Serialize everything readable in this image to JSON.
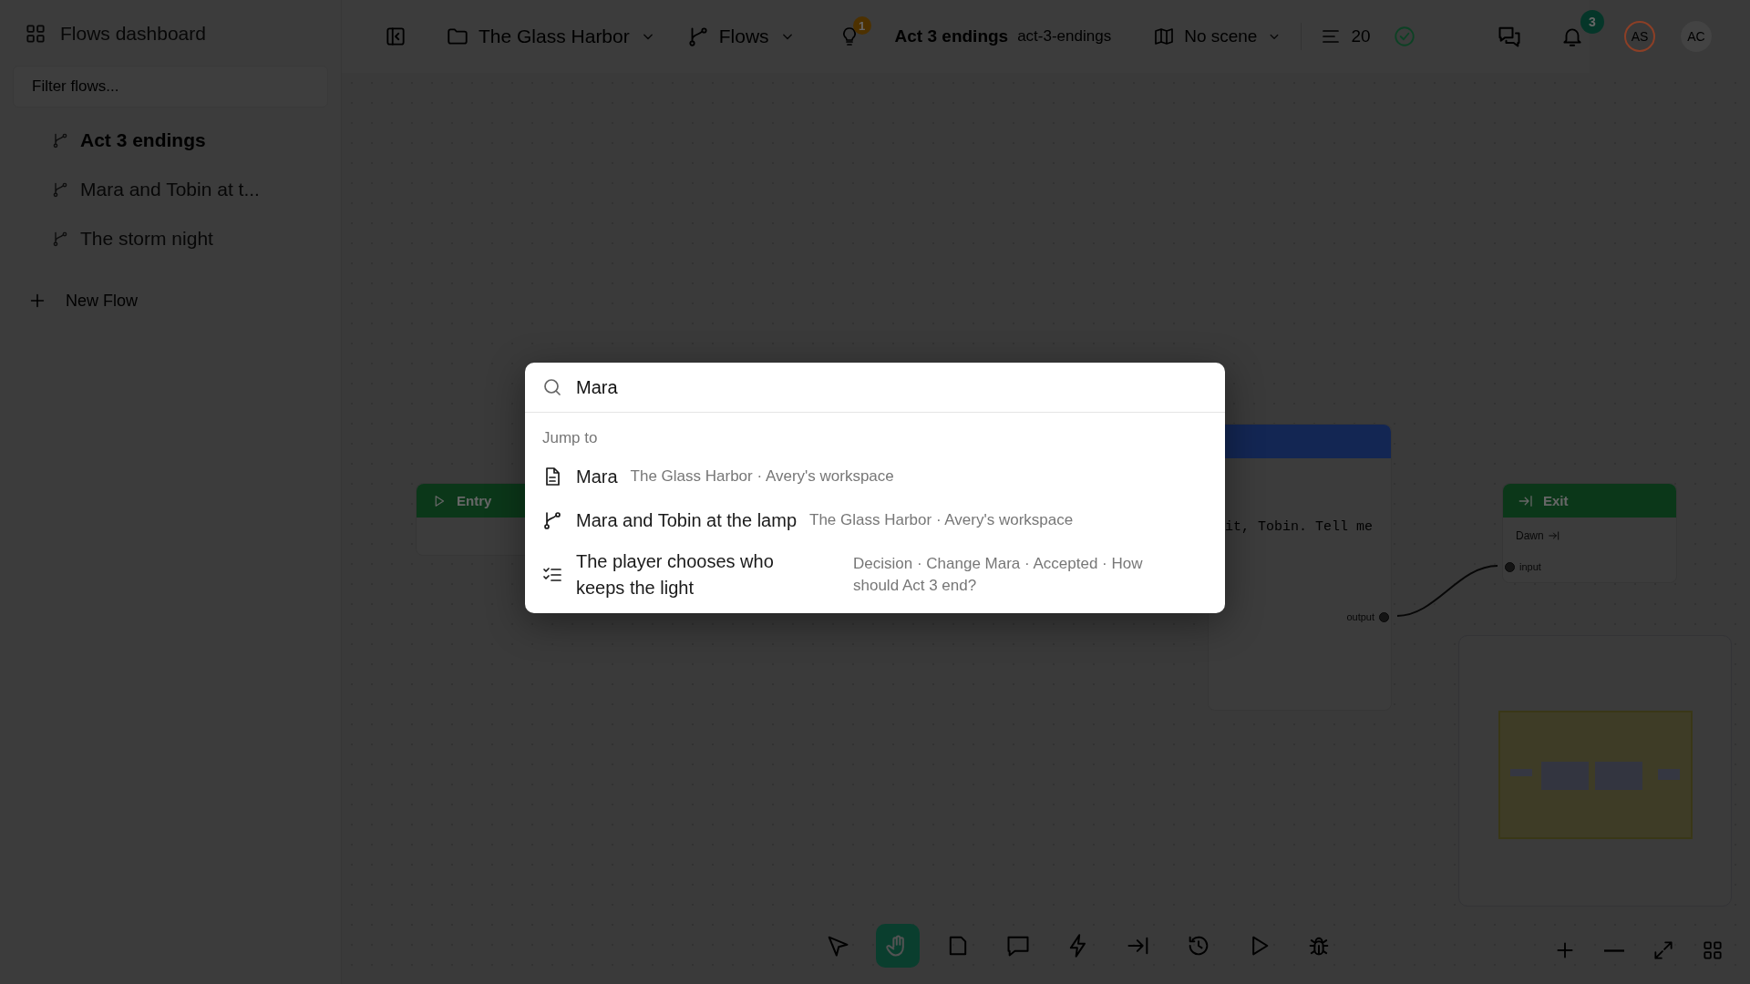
{
  "sidebar": {
    "title": "Flows dashboard",
    "filter": {
      "placeholder": "Filter flows..."
    },
    "items": [
      {
        "label": "Act 3 endings",
        "selected": true
      },
      {
        "label": "Mara and Tobin at t...",
        "selected": false
      },
      {
        "label": "The storm night",
        "selected": false
      }
    ],
    "new_button": "New Flow"
  },
  "topbar": {
    "project": "The Glass Harbor",
    "section": "Flows",
    "hint_badge": "1",
    "flow_title": "Act 3 endings",
    "flow_slug": "act-3-endings",
    "scene": "No scene",
    "count": "20",
    "notification_badge": "3",
    "avatars": [
      {
        "initials": "AS",
        "color": "#8c3f26"
      },
      {
        "initials": "AC",
        "color": "#434343"
      }
    ]
  },
  "canvas": {
    "nodes": [
      {
        "kind": "entry",
        "title": "Entry"
      },
      {
        "kind": "dialogue",
        "text": "it, Tobin. Tell me",
        "port": "output"
      },
      {
        "kind": "exit",
        "title": "Exit",
        "label": "Dawn",
        "port": "input"
      }
    ]
  },
  "toolbar": {
    "tools": [
      {
        "kind": "select",
        "selected": false
      },
      {
        "kind": "hand",
        "selected": true
      },
      {
        "kind": "page",
        "selected": false
      },
      {
        "kind": "comment",
        "selected": false
      },
      {
        "kind": "bolt",
        "selected": false
      },
      {
        "kind": "exit",
        "selected": false
      },
      {
        "kind": "history",
        "selected": false
      },
      {
        "kind": "play",
        "selected": false
      },
      {
        "kind": "bug",
        "selected": false
      }
    ]
  },
  "palette": {
    "query": "Mara",
    "section": "Jump to",
    "results": [
      {
        "kind": "document",
        "title": "Mara",
        "meta": "The Glass Harbor · Avery's workspace"
      },
      {
        "kind": "flow",
        "title": "Mara and Tobin at the lamp",
        "meta": "The Glass Harbor · Avery's workspace"
      },
      {
        "kind": "decision",
        "title": "The player chooses who keeps the light",
        "meta": "Decision · Change Mara · Accepted · How should Act 3 end?"
      }
    ]
  }
}
